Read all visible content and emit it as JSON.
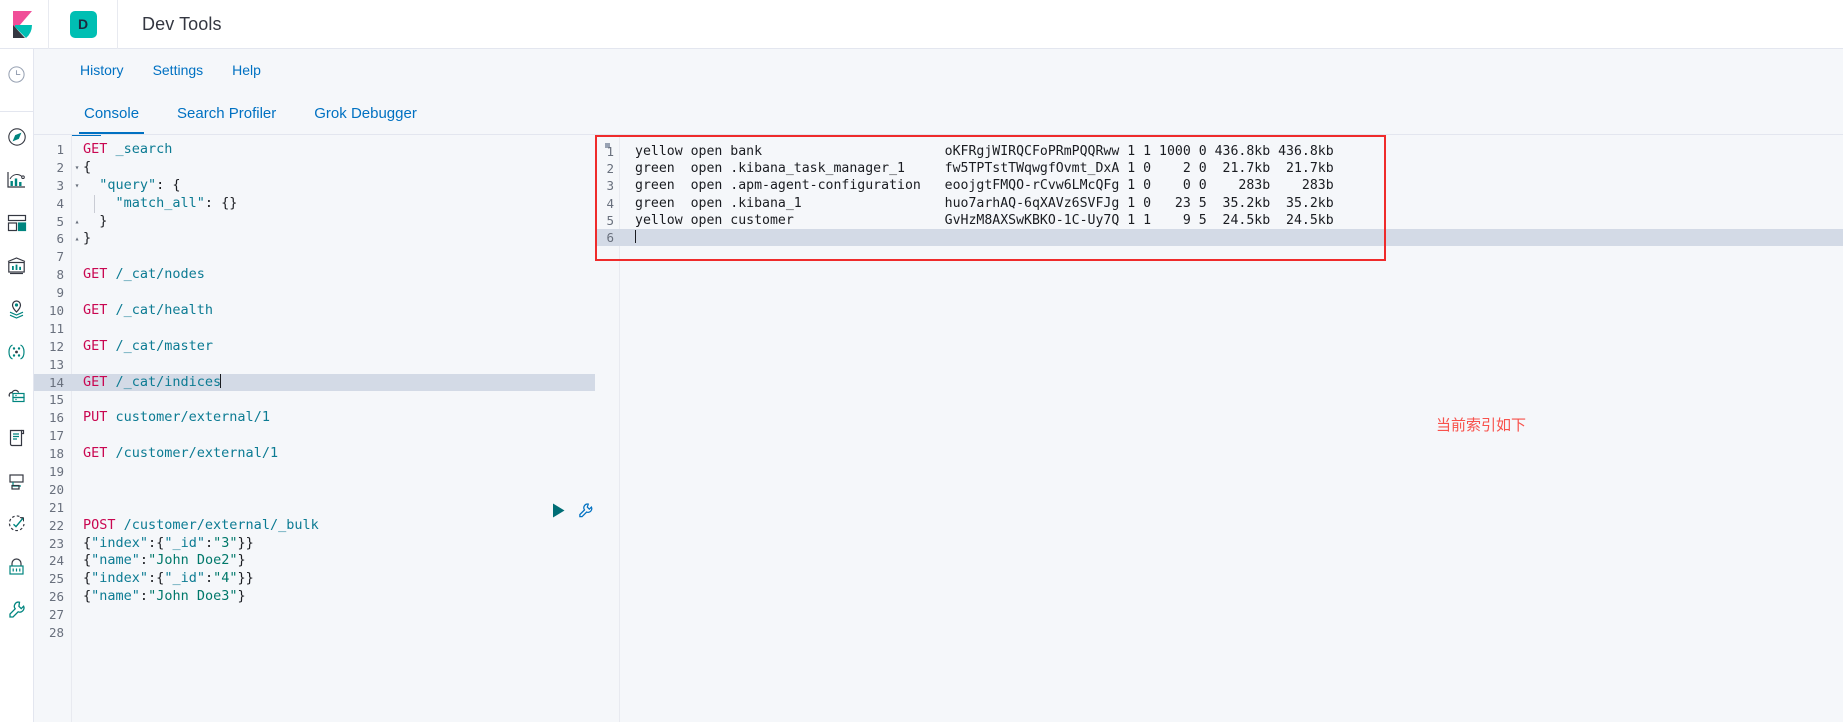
{
  "header": {
    "logo_icon": "kibana-logo-icon",
    "app_badge": "D",
    "app_title": "Dev Tools"
  },
  "rail": {
    "items": [
      {
        "name": "recently-viewed",
        "icon": "clock-icon"
      },
      {
        "name": "discover",
        "icon": "compass-icon"
      },
      {
        "name": "visualize",
        "icon": "bar-chart-icon"
      },
      {
        "name": "dashboard",
        "icon": "dashboard-grid-icon"
      },
      {
        "name": "canvas",
        "icon": "presentation-icon"
      },
      {
        "name": "maps",
        "icon": "map-pin-layers-icon"
      },
      {
        "name": "machine-learning",
        "icon": "nodes-network-icon"
      },
      {
        "name": "infrastructure",
        "icon": "server-cloud-icon"
      },
      {
        "name": "logs",
        "icon": "document-scroll-icon"
      },
      {
        "name": "apm",
        "icon": "apm-monitor-icon"
      },
      {
        "name": "uptime",
        "icon": "uptime-check-icon"
      },
      {
        "name": "security",
        "icon": "lock-icon"
      },
      {
        "name": "dev-tools",
        "icon": "wrench-icon"
      }
    ]
  },
  "menubar": {
    "items": [
      {
        "label": "History",
        "name": "menu-history"
      },
      {
        "label": "Settings",
        "name": "menu-settings"
      },
      {
        "label": "Help",
        "name": "menu-help"
      }
    ]
  },
  "tabs": [
    {
      "label": "Console",
      "name": "tab-console",
      "active": true
    },
    {
      "label": "Search Profiler",
      "name": "tab-search-profiler",
      "active": false
    },
    {
      "label": "Grok Debugger",
      "name": "tab-grok-debugger",
      "active": false
    }
  ],
  "editor": {
    "active_line": 14,
    "lines": [
      {
        "n": 1,
        "fold": "",
        "tokens": [
          {
            "t": "m",
            "v": "GET"
          },
          {
            "t": "u",
            "v": " _search"
          }
        ]
      },
      {
        "n": 2,
        "fold": "▾",
        "tokens": [
          {
            "t": "p",
            "v": "{"
          }
        ]
      },
      {
        "n": 3,
        "fold": "▾",
        "tokens": [
          {
            "t": "p",
            "v": "  "
          },
          {
            "t": "k",
            "v": "\"query\""
          },
          {
            "t": "p",
            "v": ": {"
          }
        ]
      },
      {
        "n": 4,
        "fold": "",
        "tokens": [
          {
            "t": "p",
            "v": "    "
          },
          {
            "t": "k",
            "v": "\"match_all\""
          },
          {
            "t": "p",
            "v": ": {}"
          }
        ]
      },
      {
        "n": 5,
        "fold": "▴",
        "tokens": [
          {
            "t": "p",
            "v": "  }"
          }
        ]
      },
      {
        "n": 6,
        "fold": "▴",
        "tokens": [
          {
            "t": "p",
            "v": "}"
          }
        ]
      },
      {
        "n": 7,
        "fold": "",
        "tokens": []
      },
      {
        "n": 8,
        "fold": "",
        "tokens": [
          {
            "t": "m",
            "v": "GET"
          },
          {
            "t": "u",
            "v": " /_cat/nodes"
          }
        ]
      },
      {
        "n": 9,
        "fold": "",
        "tokens": []
      },
      {
        "n": 10,
        "fold": "",
        "tokens": [
          {
            "t": "m",
            "v": "GET"
          },
          {
            "t": "u",
            "v": " /_cat/health"
          }
        ]
      },
      {
        "n": 11,
        "fold": "",
        "tokens": []
      },
      {
        "n": 12,
        "fold": "",
        "tokens": [
          {
            "t": "m",
            "v": "GET"
          },
          {
            "t": "u",
            "v": " /_cat/master"
          }
        ]
      },
      {
        "n": 13,
        "fold": "",
        "tokens": []
      },
      {
        "n": 14,
        "fold": "",
        "tokens": [
          {
            "t": "m",
            "v": "GET"
          },
          {
            "t": "u",
            "v": " /_cat/indices"
          }
        ],
        "caret": true
      },
      {
        "n": 15,
        "fold": "",
        "tokens": []
      },
      {
        "n": 16,
        "fold": "",
        "tokens": [
          {
            "t": "m",
            "v": "PUT"
          },
          {
            "t": "u",
            "v": " customer/external/1"
          }
        ]
      },
      {
        "n": 17,
        "fold": "",
        "tokens": []
      },
      {
        "n": 18,
        "fold": "",
        "tokens": [
          {
            "t": "m",
            "v": "GET"
          },
          {
            "t": "u",
            "v": " /customer/external/1"
          }
        ]
      },
      {
        "n": 19,
        "fold": "",
        "tokens": []
      },
      {
        "n": 20,
        "fold": "",
        "tokens": []
      },
      {
        "n": 21,
        "fold": "",
        "tokens": []
      },
      {
        "n": 22,
        "fold": "",
        "tokens": [
          {
            "t": "m",
            "v": "POST"
          },
          {
            "t": "u",
            "v": " /customer/external/_bulk"
          }
        ]
      },
      {
        "n": 23,
        "fold": "",
        "tokens": [
          {
            "t": "p",
            "v": "{"
          },
          {
            "t": "k",
            "v": "\"index\""
          },
          {
            "t": "p",
            "v": ":{"
          },
          {
            "t": "k",
            "v": "\"_id\""
          },
          {
            "t": "p",
            "v": ":"
          },
          {
            "t": "s",
            "v": "\"3\""
          },
          {
            "t": "p",
            "v": "}}"
          }
        ]
      },
      {
        "n": 24,
        "fold": "",
        "tokens": [
          {
            "t": "p",
            "v": "{"
          },
          {
            "t": "k",
            "v": "\"name\""
          },
          {
            "t": "p",
            "v": ":"
          },
          {
            "t": "s",
            "v": "\"John Doe2\""
          },
          {
            "t": "p",
            "v": "}"
          }
        ]
      },
      {
        "n": 25,
        "fold": "",
        "tokens": [
          {
            "t": "p",
            "v": "{"
          },
          {
            "t": "k",
            "v": "\"index\""
          },
          {
            "t": "p",
            "v": ":{"
          },
          {
            "t": "k",
            "v": "\"_id\""
          },
          {
            "t": "p",
            "v": ":"
          },
          {
            "t": "s",
            "v": "\"4\""
          },
          {
            "t": "p",
            "v": "}}"
          }
        ]
      },
      {
        "n": 26,
        "fold": "",
        "tokens": [
          {
            "t": "p",
            "v": "{"
          },
          {
            "t": "k",
            "v": "\"name\""
          },
          {
            "t": "p",
            "v": ":"
          },
          {
            "t": "s",
            "v": "\"John Doe3\""
          },
          {
            "t": "p",
            "v": "}"
          }
        ]
      },
      {
        "n": 27,
        "fold": "",
        "tokens": []
      },
      {
        "n": 28,
        "fold": "",
        "tokens": []
      }
    ],
    "run_button_icon": "play-triangle-icon",
    "wrench_button_icon": "wrench-icon",
    "resize_handle_icon": "vertical-dots-icon"
  },
  "output": {
    "highlight_color": "#ef2b2b",
    "lines": [
      {
        "n": 1,
        "text": "yellow open bank                       oKFRgjWIRQCFoPRmPQQRww 1 1 1000 0 436.8kb 436.8kb"
      },
      {
        "n": 2,
        "text": "green  open .kibana_task_manager_1     fw5TPTstTWqwgfOvmt_DxA 1 0    2 0  21.7kb  21.7kb"
      },
      {
        "n": 3,
        "text": "green  open .apm-agent-configuration   eoojgtFMQO-rCvw6LMcQFg 1 0    0 0    283b    283b"
      },
      {
        "n": 4,
        "text": "green  open .kibana_1                  huo7arhAQ-6qXAVz6SVFJg 1 0   23 5  35.2kb  35.2kb"
      },
      {
        "n": 5,
        "text": "yellow open customer                   GvHzM8AXSwKBKO-1C-Uy7Q 1 1    9 5  24.5kb  24.5kb"
      },
      {
        "n": 6,
        "text": "",
        "caret": true,
        "selected": true
      }
    ],
    "annotation": "当前索引如下"
  }
}
